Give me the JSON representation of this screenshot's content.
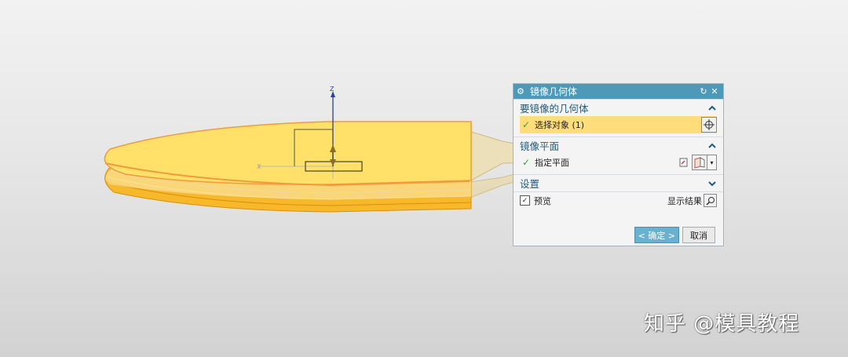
{
  "dialog": {
    "title": "镜像几何体",
    "section1": {
      "label": "要镜像的几何体",
      "row_label": "选择对象 (1)"
    },
    "section2": {
      "label": "镜像平面",
      "row_label": "指定平面"
    },
    "section3": {
      "label": "设置"
    },
    "preview_label": "预览",
    "show_result_label": "显示结果",
    "ok_label": "< 确定 >",
    "cancel_label": "取消"
  },
  "viewport": {
    "axis_z_label": "Z",
    "axis_x_label": "X"
  },
  "watermark": "知乎 @模具教程",
  "colors": {
    "accent": "#4e98b8",
    "highlight": "#ffdd7a",
    "part_top": "#ffe16a",
    "part_edge": "#f5a623"
  }
}
